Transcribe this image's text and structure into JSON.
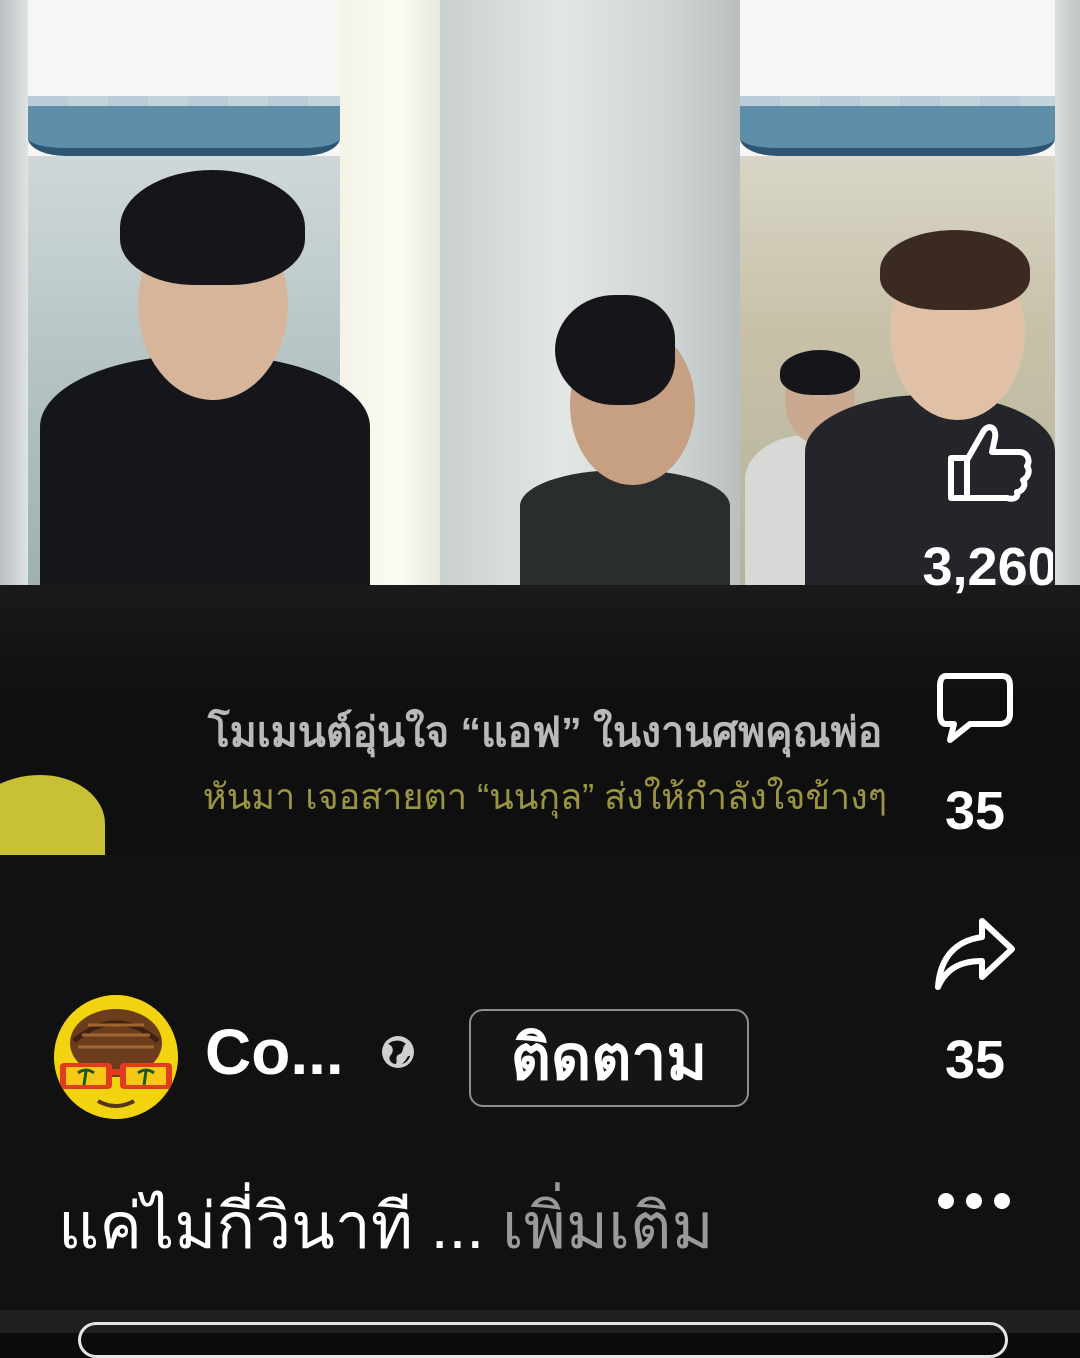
{
  "video": {
    "caption_line1": "โมเมนต์อุ่นใจ “แอฟ” ในงานศพคุณพ่อ",
    "caption_line2": "หันมา เจอสายตา “นนกุล” ส่งให้กำลังใจข้างๆ"
  },
  "actions": {
    "like_count": "3,260",
    "comment_count": "35",
    "share_count": "35"
  },
  "author": {
    "name": "Co...",
    "follow_label": "ติดตาม"
  },
  "description": {
    "text": "แค่ไม่กี่วินาที",
    "ellipsis": " ... ",
    "more_label": "เพิ่มเติม"
  },
  "colors": {
    "background": "#111111",
    "caption_primary": "#b9b9b9",
    "caption_secondary": "#9c9540",
    "avatar_bg": "#f2d30f"
  },
  "icons": [
    "like-icon",
    "comment-icon",
    "share-icon",
    "globe-icon",
    "more-icon"
  ]
}
